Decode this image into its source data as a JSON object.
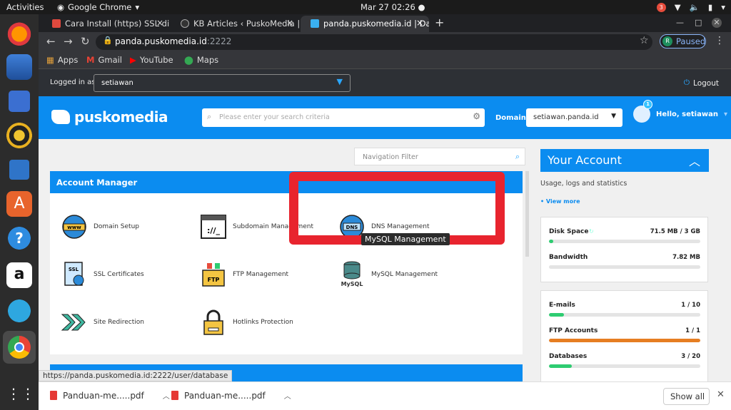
{
  "system_bar": {
    "activities": "Activities",
    "app": "Google Chrome",
    "clock": "Mar 27  02:26 ●",
    "notif_count": "3"
  },
  "tabs": [
    {
      "title": "Cara Install (https) SSL di",
      "close": "×"
    },
    {
      "title": "KB Articles ‹ PuskoMedia |",
      "close": "×"
    },
    {
      "title": "panda.puskomedia.id | Da",
      "close": "×"
    }
  ],
  "toolbar": {
    "url_host": "panda.puskomedia.id",
    "url_port": ":2222",
    "profile_initial": "R",
    "profile_status": "Paused"
  },
  "bookmarks": [
    "Apps",
    "Gmail",
    "YouTube",
    "Maps"
  ],
  "login": {
    "label": "Logged in as",
    "user": "setiawan",
    "logout": "Logout"
  },
  "header": {
    "logo": "puskomedia",
    "search_placeholder": "Please enter your search criteria",
    "domain_label": "Domain",
    "domain_value": "setiawan.panda.id",
    "hello": "Hello, setiawan",
    "notif": "1"
  },
  "nav_filter_placeholder": "Navigation Filter",
  "account_manager": {
    "title": "Account Manager",
    "items": [
      "Domain Setup",
      "Subdomain Management",
      "DNS Management",
      "SSL Certificates",
      "FTP Management",
      "MySQL Management",
      "Site Redirection",
      "Hotlinks Protection"
    ],
    "tooltip": "MySQL Management"
  },
  "status_url": "https://panda.puskomedia.id:2222/user/database",
  "your_account": {
    "title": "Your Account",
    "subtitle": "Usage, logs and statistics",
    "view_more": "• View more",
    "stats": [
      {
        "label": "Disk Space",
        "value": "71.5 MB / 3 GB",
        "fraction": 0.024,
        "color": "#2ecc71"
      },
      {
        "label": "Bandwidth",
        "value": "7.82 MB",
        "fraction": 0.0,
        "color": "#2ecc71"
      },
      {
        "label": "E-mails",
        "value": "1 / 10",
        "fraction": 0.1,
        "color": "#2ecc71"
      },
      {
        "label": "FTP Accounts",
        "value": "1 / 1",
        "fraction": 1.0,
        "color": "#e67e22"
      },
      {
        "label": "Databases",
        "value": "3 / 20",
        "fraction": 0.15,
        "color": "#2ecc71"
      }
    ]
  },
  "downloads": {
    "files": [
      "Panduan-me.....pdf",
      "Panduan-me.....pdf"
    ],
    "show_all": "Show all"
  }
}
